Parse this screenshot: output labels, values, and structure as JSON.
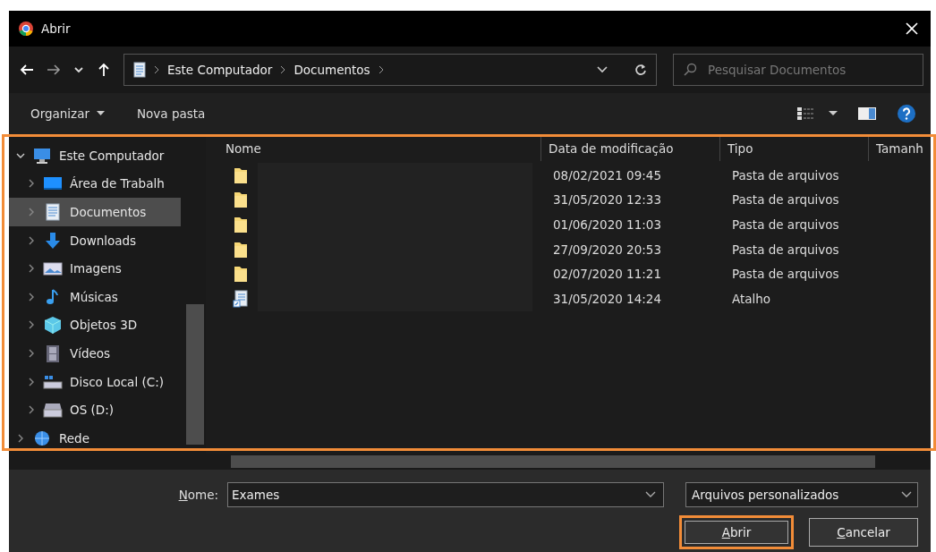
{
  "window": {
    "title": "Abrir"
  },
  "nav": {
    "path": [
      "Este Computador",
      "Documentos"
    ],
    "search_placeholder": "Pesquisar Documentos"
  },
  "toolbar": {
    "organize": "Organizar",
    "new_folder": "Nova pasta"
  },
  "sidebar": {
    "items": [
      {
        "label": "Este Computador",
        "kind": "computer",
        "expanded": true,
        "selected": false,
        "children": [
          {
            "label": "Área de Trabalh",
            "kind": "desktop",
            "expanded": false,
            "selected": false
          },
          {
            "label": "Documentos",
            "kind": "documents",
            "expanded": false,
            "selected": true
          },
          {
            "label": "Downloads",
            "kind": "downloads",
            "expanded": false,
            "selected": false
          },
          {
            "label": "Imagens",
            "kind": "pictures",
            "expanded": false,
            "selected": false
          },
          {
            "label": "Músicas",
            "kind": "music",
            "expanded": false,
            "selected": false
          },
          {
            "label": "Objetos 3D",
            "kind": "objects",
            "expanded": false,
            "selected": false
          },
          {
            "label": "Vídeos",
            "kind": "videos",
            "expanded": false,
            "selected": false
          },
          {
            "label": "Disco Local (C:)",
            "kind": "system-drive",
            "expanded": false,
            "selected": false
          },
          {
            "label": "OS (D:)",
            "kind": "drive",
            "expanded": false,
            "selected": false
          }
        ]
      },
      {
        "label": "Rede",
        "kind": "network",
        "expanded": false,
        "selected": false
      }
    ]
  },
  "file_list": {
    "highlighted": true,
    "columns": [
      "Nome",
      "Data de modificação",
      "Tipo",
      "Tamanh"
    ],
    "rows": [
      {
        "kind": "folder",
        "modified": "08/02/2021 09:45",
        "type": "Pasta de arquivos"
      },
      {
        "kind": "folder",
        "modified": "31/05/2020 12:33",
        "type": "Pasta de arquivos"
      },
      {
        "kind": "folder",
        "modified": "01/06/2020 11:03",
        "type": "Pasta de arquivos"
      },
      {
        "kind": "folder",
        "modified": "27/09/2020 20:53",
        "type": "Pasta de arquivos"
      },
      {
        "kind": "folder",
        "modified": "02/07/2020 11:21",
        "type": "Pasta de arquivos"
      },
      {
        "kind": "shortcut",
        "modified": "31/05/2020 14:24",
        "type": "Atalho"
      }
    ]
  },
  "footer": {
    "name_label": "Nome:",
    "name_value": "Exames",
    "filter": "Arquivos personalizados",
    "buttons": [
      {
        "label": "Abrir",
        "highlighted": true
      },
      {
        "label": "Cancelar",
        "highlighted": false
      }
    ]
  }
}
